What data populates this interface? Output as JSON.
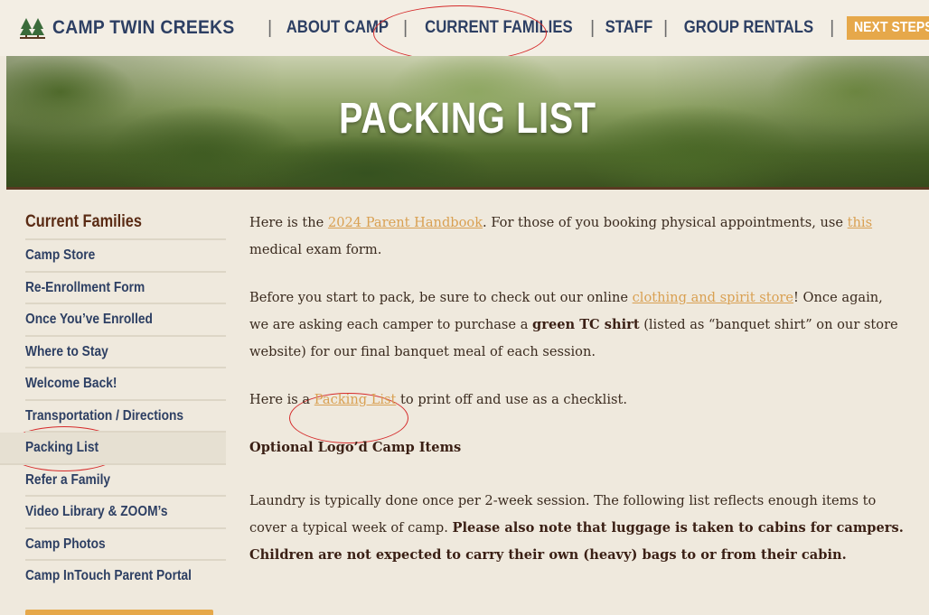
{
  "header": {
    "logo_text": "CAMP TWIN CREEKS",
    "nav": {
      "about": "ABOUT CAMP",
      "current_families": "CURRENT FAMILIES",
      "staff": "STAFF",
      "group_rentals": "GROUP RENTALS",
      "next_steps": "NEXT STEPS"
    }
  },
  "hero": {
    "title": "PACKING LIST"
  },
  "sidebar": {
    "heading": "Current Families",
    "items": [
      {
        "label": "Camp Store"
      },
      {
        "label": "Re-Enrollment Form"
      },
      {
        "label": "Once You’ve Enrolled"
      },
      {
        "label": "Where to Stay"
      },
      {
        "label": "Welcome Back!"
      },
      {
        "label": "Transportation / Directions"
      },
      {
        "label": "Packing List"
      },
      {
        "label": "Refer a Family"
      },
      {
        "label": "Video Library & ZOOM’s"
      },
      {
        "label": "Camp Photos"
      },
      {
        "label": "Camp InTouch Parent Portal"
      }
    ],
    "active_item": "Packing List"
  },
  "content": {
    "p1": {
      "t1": "Here is the ",
      "link1": "2024 Parent Handbook",
      "t2": ".  For those of you booking physical appointments, use ",
      "link2": "this",
      "t3": " medical exam form."
    },
    "p2": {
      "t1": "Before you start to pack, be sure to check out our online ",
      "link1": "clothing and spirit store",
      "t2": "!  Once again, we are asking each camper to purchase a ",
      "bold1": "green TC shirt",
      "t3": " (listed as “banquet shirt” on our store website) for our final banquet meal of each session."
    },
    "p3": {
      "t1": "Here is a ",
      "link1": "Packing List",
      "t2": " to print off and use as a checklist."
    },
    "subheading": "Optional Logo’d Camp Items",
    "p4": {
      "t1": "Laundry is typically done once per 2-week session.  The following list reflects enough items to cover a typical week of camp.  ",
      "bold1": "Please also note that luggage is taken to cabins for campers.  Children are not expected to carry their own (heavy) bags to or from their cabin."
    }
  },
  "colors": {
    "navy": "#2d3f63",
    "brown": "#5a2b14",
    "accent_orange": "#e6a84a",
    "link": "#d9a052",
    "background": "#efe9dd",
    "annotation_red": "#d52b2b"
  },
  "icons": {
    "logo": "pine-trees-icon",
    "next_steps": "chevron-down-icon"
  }
}
